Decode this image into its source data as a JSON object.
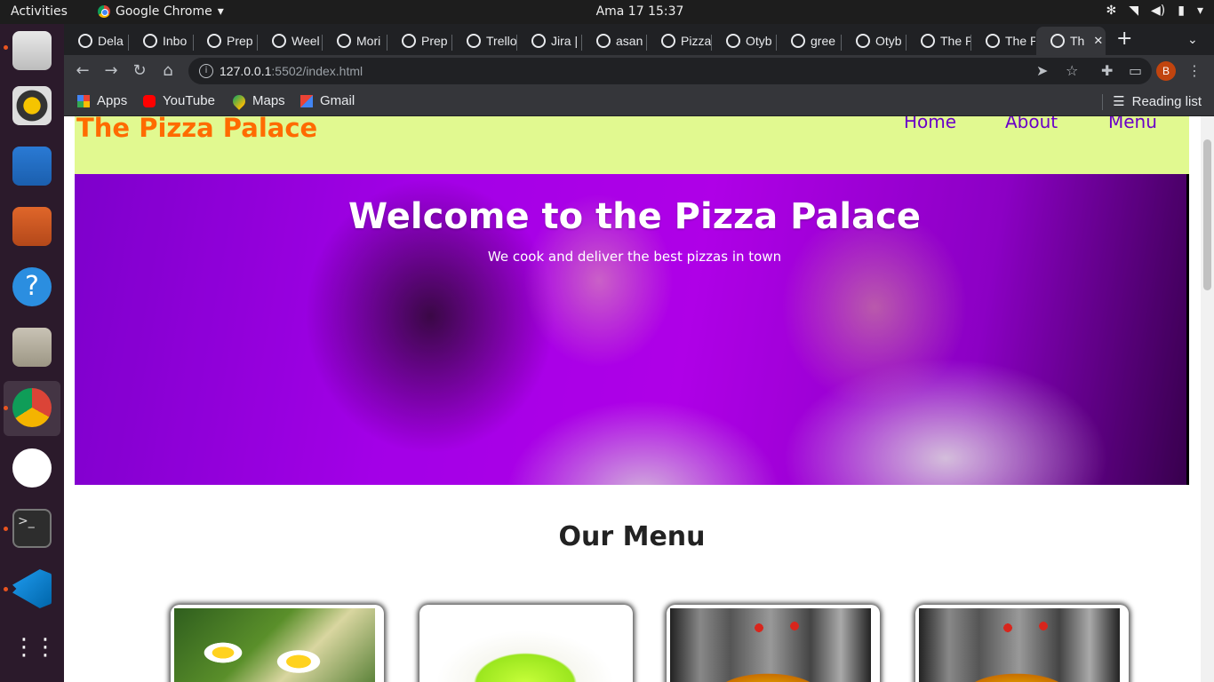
{
  "system": {
    "activities": "Activities",
    "app_name": "Google Chrome",
    "clock": "Ama 17  15:37"
  },
  "browser": {
    "tabs": [
      {
        "label": "Dela",
        "icon": "globe-icon"
      },
      {
        "label": "Inbo",
        "icon": "gmail-icon"
      },
      {
        "label": "Prep",
        "icon": "sheets-icon"
      },
      {
        "label": "Weel",
        "icon": "plant-icon"
      },
      {
        "label": "Mori",
        "icon": "calendar-icon"
      },
      {
        "label": "Prep",
        "icon": "sheets-icon"
      },
      {
        "label": "Trello",
        "icon": "trello-icon"
      },
      {
        "label": "Jira |",
        "icon": "jira-icon"
      },
      {
        "label": "asan",
        "icon": "google-icon"
      },
      {
        "label": "Pizza",
        "icon": "globe-icon"
      },
      {
        "label": "Otyb",
        "icon": "github-icon"
      },
      {
        "label": "gree",
        "icon": "google-icon"
      },
      {
        "label": "Otyb",
        "icon": "github-icon"
      },
      {
        "label": "The P",
        "icon": "globe-icon"
      },
      {
        "label": "The P",
        "icon": "globe-icon"
      },
      {
        "label": "Th",
        "icon": "globe-icon",
        "active": true
      }
    ],
    "url_host": "127.0.0.1",
    "url_rest": ":5502/index.html",
    "profile_initial": "B",
    "bookmarks": [
      {
        "label": "Apps",
        "icon": "apps-grid-icon"
      },
      {
        "label": "YouTube",
        "icon": "youtube-icon"
      },
      {
        "label": "Maps",
        "icon": "maps-icon"
      },
      {
        "label": "Gmail",
        "icon": "gmail-icon"
      }
    ],
    "reading_list": "Reading list"
  },
  "page": {
    "site_title": "The Pizza Palace",
    "nav": [
      "Home",
      "About",
      "Menu"
    ],
    "hero_title": "Welcome to the Pizza Palace",
    "hero_subtitle": "We cook and deliver the best pizzas in town",
    "menu_title": "Our Menu"
  },
  "colors": {
    "header_bg": "#e1f990",
    "site_title": "#ff6b00",
    "nav_link": "#6a00c8",
    "hero_tint": "#b400ff"
  }
}
